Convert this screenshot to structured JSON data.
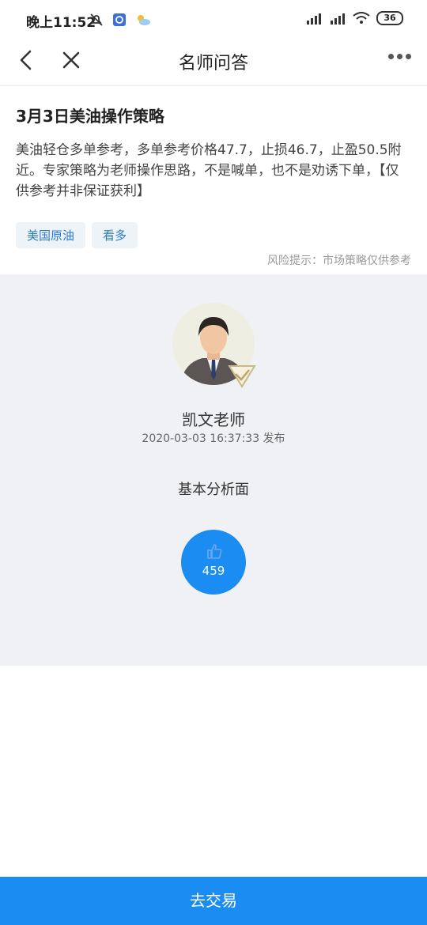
{
  "status_bar": {
    "time": "晚上11:52",
    "battery": "36"
  },
  "navbar": {
    "title": "名师问答"
  },
  "article": {
    "title": "3月3日美油操作策略",
    "body": "美油轻仓多单参考，多单参考价格47.7，止损46.7，止盈50.5附近。专家策略为老师操作思路，不是喊单，也不是劝诱下单，【仅供参考并非保证获利】",
    "tags": [
      "美国原油",
      "看多"
    ],
    "risk_note": "风险提示：市场策略仅供参考"
  },
  "teacher": {
    "name": "凯文老师",
    "published": "2020-03-03 16:37:33 发布",
    "section_label": "基本分析面",
    "likes": "459"
  },
  "bottom_button": {
    "label": "去交易"
  },
  "colors": {
    "accent": "#1a8cf2",
    "tag_text": "#2b7bd0",
    "panel_bg": "#f0f1f4"
  }
}
